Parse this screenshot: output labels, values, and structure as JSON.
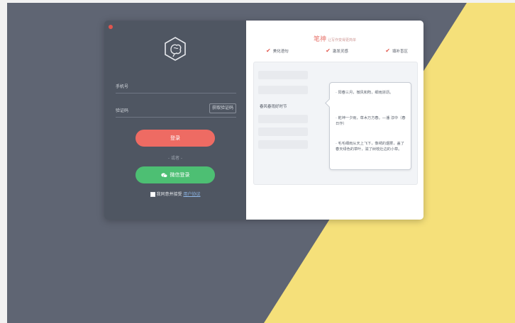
{
  "login_panel": {
    "phone_label": "手机号",
    "code_label": "验证码",
    "get_code_button": "获取验证码",
    "login_button": "登录",
    "or_text": "- 或者 -",
    "wechat_button": "微信登录",
    "agree_text": "我同意并接受",
    "agreement_link": "用户协议"
  },
  "promo": {
    "brand": "笔神",
    "tagline": "让写作变得更简单",
    "features": [
      "美化语句",
      "激发灵感",
      "填补盲区"
    ],
    "preview_title": "春风春雨好时节",
    "quotes": [
      "阳春三月，微风和煦，细雨淅沥。",
      "乾坤一夕雨，草木万方春。—潘 淳中（春日作）",
      "毛毛细雨从天上飞下，像绣的烟雾，盖了春天绿色的草叶，滋了树枝灶边的小草。"
    ]
  },
  "colors": {
    "background_dark": "#5f6573",
    "background_yellow": "#f5e07a",
    "left_panel": "#4f5662",
    "login_button": "#ee6b63",
    "wechat_button": "#4dbf73",
    "accent": "#e25c52"
  },
  "icons": {
    "logo": "hexagon-brain-logo",
    "close": "close-dot",
    "check": "check-icon",
    "wechat": "wechat-icon"
  }
}
